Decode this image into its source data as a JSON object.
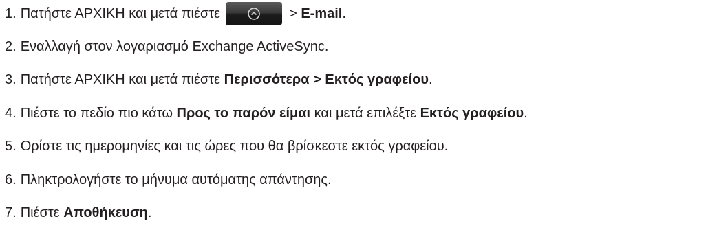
{
  "steps": [
    {
      "num": "1.",
      "parts": {
        "a": "Πατήστε ΑΡΧΙΚΗ και μετά πιέστε",
        "b": "> ",
        "c": "E-mail",
        "d": "."
      },
      "icon": "app-menu-icon"
    },
    {
      "num": "2.",
      "text": "Εναλλαγή στον λογαριασμό Exchange ActiveSync."
    },
    {
      "num": "3.",
      "parts": {
        "a": "Πατήστε ΑΡΧΙΚΗ και μετά πιέστε ",
        "b": "Περισσότερα > Εκτός γραφείου",
        "c": "."
      }
    },
    {
      "num": "4.",
      "parts": {
        "a": "Πιέστε το πεδίο πιο κάτω ",
        "b": "Προς το παρόν είμαι",
        "c": " και μετά επιλέξτε ",
        "d": "Εκτός γραφείου",
        "e": "."
      }
    },
    {
      "num": "5.",
      "text": "Ορίστε τις ημερομηνίες και τις ώρες που θα βρίσκεστε εκτός γραφείου."
    },
    {
      "num": "6.",
      "text": "Πληκτρολογήστε το μήνυμα αυτόματης απάντησης."
    },
    {
      "num": "7.",
      "parts": {
        "a": "Πιέστε ",
        "b": "Αποθήκευση",
        "c": "."
      }
    }
  ]
}
